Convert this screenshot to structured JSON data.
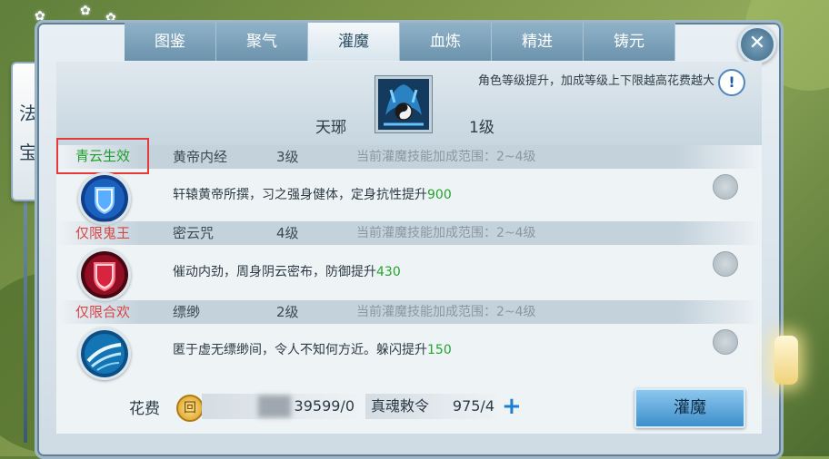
{
  "side_title": [
    "法",
    "宝"
  ],
  "tabs": [
    {
      "label": "图鉴"
    },
    {
      "label": "聚气"
    },
    {
      "label": "灌魔"
    },
    {
      "label": "血炼"
    },
    {
      "label": "精进"
    },
    {
      "label": "铸元"
    }
  ],
  "active_tab": "灌魔",
  "close_symbol": "✕",
  "tip_text": "角色等级提升，加成等级上下限越高花费越大",
  "info_symbol": "!",
  "weapon": {
    "name": "天琊",
    "level": "1级",
    "icon": "tianya-weapon-icon"
  },
  "skills": [
    {
      "condition": "青云生效",
      "condition_color": "#1e9e2c",
      "name": "黄帝内经",
      "level": "3级",
      "range": "当前灌魔技能加成范围：2~4级",
      "desc": "轩辕黄帝所撰，习之强身健体，定身抗性提升",
      "value": "900",
      "icon": "blue-shield-icon"
    },
    {
      "condition": "仅限鬼王",
      "condition_color": "#d64545",
      "name": "密云咒",
      "level": "4级",
      "range": "当前灌魔技能加成范围：2~4级",
      "desc": "催动内劲，周身阴云密布，防御提升",
      "value": "430",
      "icon": "red-shield-icon"
    },
    {
      "condition": "仅限合欢",
      "condition_color": "#d64545",
      "name": "缥缈",
      "level": "2级",
      "range": "当前灌魔技能加成范围：2~4级",
      "desc": "匿于虚无缥缈间，令人不知何方近。躲闪提升",
      "value": "150",
      "icon": "wind-swirl-icon"
    }
  ],
  "footer": {
    "cost_label": "花费",
    "coin_symbol": "回",
    "cost_value": "39599/0",
    "item_name": "真魂敕令",
    "item_count": "975/4",
    "plus_symbol": "+",
    "action_label": "灌魔"
  },
  "colors": {
    "tab_active_text": "#2f4f63",
    "value_green": "#24a32e",
    "highlight_box": "#e53a3a"
  }
}
